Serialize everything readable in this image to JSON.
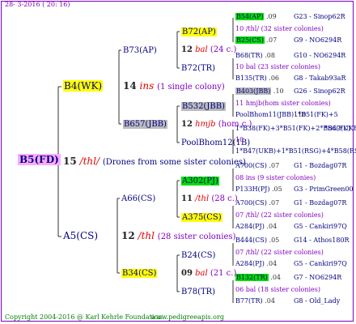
{
  "header": {
    "date_text": "28-  3-2016 ( 20: 16)"
  },
  "footer": {
    "copyright": "Copyright 2004-2016 @ Karl Kehrle Foundation.",
    "url": "www.pedigreeapis.org"
  },
  "root": {
    "id": "B5(FD)",
    "year": "15",
    "mark": "/thl/",
    "note": "(Drones from some sister colonies)"
  },
  "g1": {
    "upper": {
      "id": "B4(WK)",
      "year": "14",
      "mark": "ins",
      "note": "(1 single colony)"
    },
    "lower": {
      "id": "A5(CS)",
      "year": "12",
      "mark": "/thl",
      "note": "(28 sister colonies)"
    }
  },
  "g2": {
    "u_top": {
      "id": "B73(AP)"
    },
    "u_bot": {
      "id": "B657(JBB)"
    },
    "l_top": {
      "id": "A66(CS)"
    },
    "l_bot": {
      "id": "B34(CS)"
    }
  },
  "g3": [
    {
      "id": "B72(AP)",
      "year": "12",
      "mark": "bal",
      "note": "(24 c.)"
    },
    {
      "id": "B72(TR)"
    },
    {
      "id": "B532(JBB)",
      "year": "12",
      "mark": "hmjb",
      "note": "(hom c.)"
    },
    {
      "id": "PoolBhom12(1B)"
    },
    {
      "id": "A302(PJ)",
      "year": "11",
      "mark": "/thl",
      "note": "(28 c.)"
    },
    {
      "id": "A375(CS)"
    },
    {
      "id": "B24(CS)",
      "year": "09",
      "mark": "bal",
      "note": "(21 c.)"
    },
    {
      "id": "B78(TR)"
    }
  ],
  "g4": [
    {
      "id": "B54(AP)",
      "num": ".09",
      "right": "G23 - Sinop62R"
    },
    {
      "line": "10 /thl/ (32 sister colonies)"
    },
    {
      "id": "B25(CS)",
      "num": ".07",
      "right": "G9 - NO6294R"
    },
    {
      "id": "B68(TR)",
      "num": ".08",
      "right": "G10 - NO6294R"
    },
    {
      "line": "10 bal (23 sister colonies)"
    },
    {
      "id": "B135(TR)",
      "num": ".06",
      "right": "G8 - Takab93aR"
    },
    {
      "id": "B403(JBB)",
      "num": ".10",
      "right": "G26 - Sinop62R"
    },
    {
      "line": "11 hmjb(hom sister colonies)"
    },
    {
      "id": "PoolBhom11(JBB)",
      "num": ".10",
      "right": "1*B51(FK)+5"
    },
    {
      "id": "1*B38(FK)+3*B51(FK)+2*B56(FK)",
      "num": "",
      "right": "*B47(UKB)+1*B5"
    },
    {
      "line": "10"
    },
    {
      "id": "1*B47(UKB)+1*B51(RSG)+4*B58(RSG)+",
      "num": "",
      "right": ""
    },
    {
      "id": "A700(CS)",
      "num": ".07",
      "right": "G1 - Bozdag07R"
    },
    {
      "line": "08 ins (9 sister colonies)"
    },
    {
      "id": "P133H(PJ)",
      "num": ".05",
      "right": "G3 - PrimGreen00"
    },
    {
      "id": "A700(CS)",
      "num": ".07",
      "right": "G1 - Bozdag07R"
    },
    {
      "line": "07 /thl/ (22 sister colonies)"
    },
    {
      "id": "A284(PJ)",
      "num": ".04",
      "right": "G5 - Cankiri97Q"
    },
    {
      "id": "B444(CS)",
      "num": ".05",
      "right": "G14 - Athos180R"
    },
    {
      "line": "07 /thl/ (22 sister colonies)"
    },
    {
      "id": "A284(PJ)",
      "num": ".04",
      "right": "G5 - Cankiri97Q"
    },
    {
      "id": "B132(TR)",
      "num": ".04",
      "right": "G7 - NO6294R"
    },
    {
      "line": "06 bal (18 sister colonies)"
    },
    {
      "id": "B77(TR)",
      "num": ".04",
      "right": "G8 - Old_Lady"
    }
  ],
  "colors": {
    "accent": "#8000c0",
    "mark": "#e00000",
    "highlight_yellow": "#ffff00",
    "highlight_green": "#00dd00",
    "highlight_gray": "#bbbbbb",
    "highlight_pink": "#ffaaff"
  }
}
